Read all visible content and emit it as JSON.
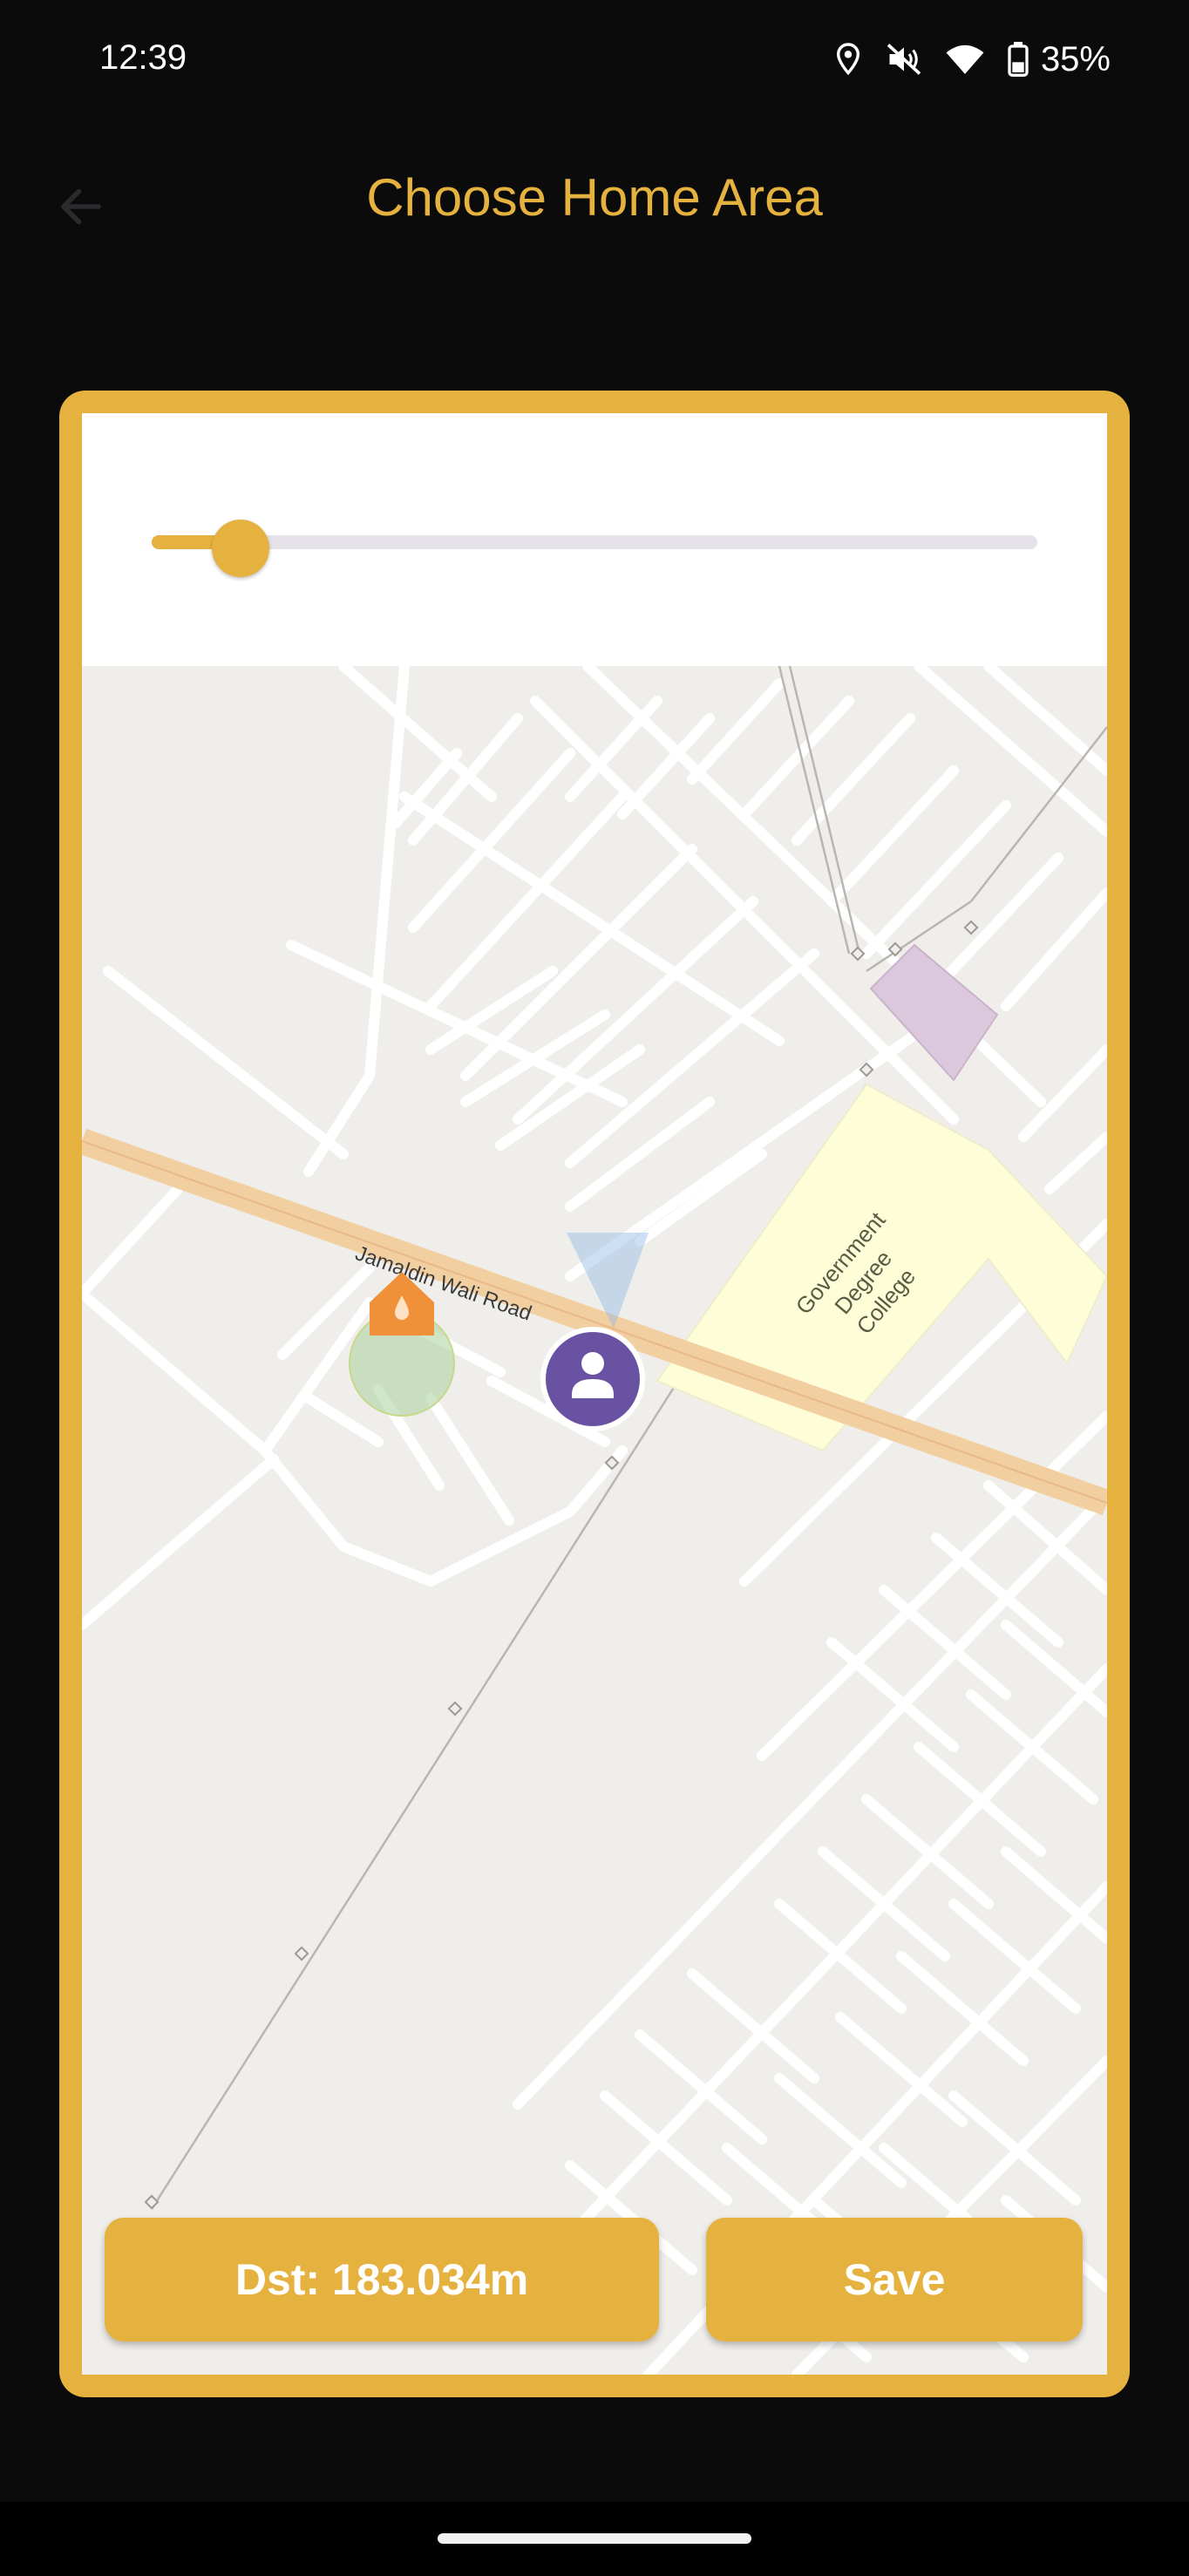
{
  "status_bar": {
    "time": "12:39",
    "battery": "35%",
    "icons": [
      "location-icon",
      "mute-icon",
      "wifi-icon",
      "battery-icon"
    ]
  },
  "header": {
    "title": "Choose Home Area",
    "back_icon": "arrow-back-icon"
  },
  "slider": {
    "value_fraction": 0.1
  },
  "map": {
    "road_label": "Jamaldin Wali Road",
    "poi_label_lines": [
      "Government",
      "Degree",
      "College"
    ],
    "markers": [
      "home-marker-icon",
      "user-location-icon"
    ]
  },
  "buttons": {
    "distance_label": "Dst: 183.034m",
    "save_label": "Save"
  },
  "colors": {
    "accent": "#e6b23f",
    "background": "#0b0b0c",
    "user_marker": "#6a52a3",
    "home_marker": "#f0913a"
  }
}
